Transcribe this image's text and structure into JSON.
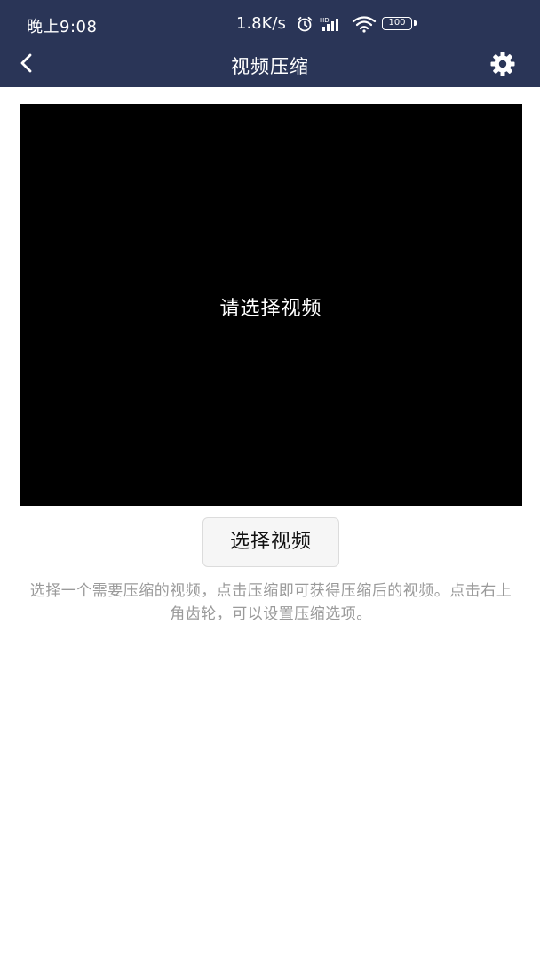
{
  "status_bar": {
    "time": "晚上9:08",
    "net_speed": "1.8K/s",
    "battery": "100",
    "colors": {
      "background": "#2a3557",
      "foreground": "#ffffff"
    },
    "icons": [
      "alarm-icon",
      "signal-icon",
      "wifi-icon",
      "battery-icon"
    ]
  },
  "app_bar": {
    "title": "视频压缩",
    "back_icon": "chevron-left-icon",
    "settings_icon": "gear-icon",
    "background": "#2a3557"
  },
  "preview": {
    "placeholder": "请选择视频",
    "background": "#000000"
  },
  "actions": {
    "select_video_label": "选择视频"
  },
  "help": {
    "text": "选择一个需要压缩的视频，点击压缩即可获得压缩后的视频。点击右上角齿轮，可以设置压缩选项。"
  }
}
